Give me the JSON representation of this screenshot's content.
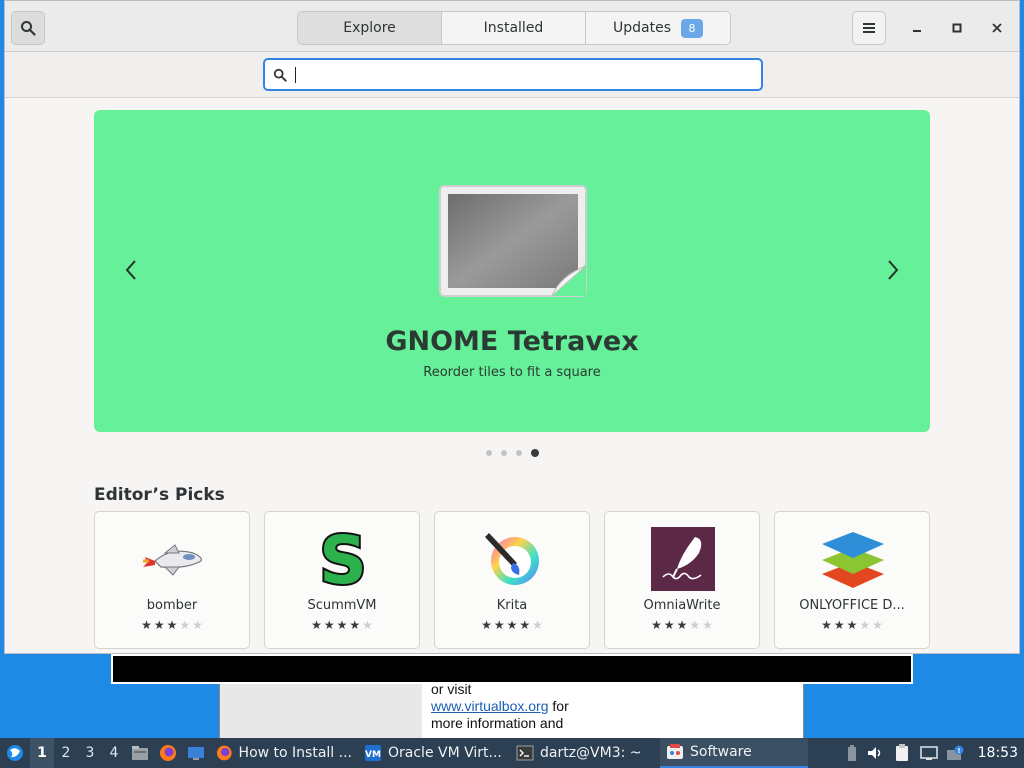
{
  "header": {
    "tabs": [
      {
        "label": "Explore",
        "active": true
      },
      {
        "label": "Installed",
        "active": false
      },
      {
        "label": "Updates",
        "active": false,
        "badge": "8"
      }
    ],
    "icons": {
      "search": "search-icon",
      "menu": "hamburger-menu-icon",
      "minimize": "minimize-icon",
      "maximize": "maximize-icon",
      "close": "close-icon"
    }
  },
  "search": {
    "placeholder": "",
    "value": ""
  },
  "banner": {
    "title": "GNOME Tetravex",
    "subtitle": "Reorder tiles to fit a square",
    "background": "#66f09a",
    "carousel_total": 4,
    "carousel_active": 4
  },
  "editors_picks": {
    "title": "Editor’s Picks",
    "apps": [
      {
        "name": "bomber",
        "rating": 3,
        "icon": "bomber-icon"
      },
      {
        "name": "ScummVM",
        "rating": 4,
        "icon": "scummvm-icon"
      },
      {
        "name": "Krita",
        "rating": 4,
        "icon": "krita-icon"
      },
      {
        "name": "OmniaWrite",
        "rating": 3,
        "icon": "omniawrite-icon"
      },
      {
        "name": "ONLYOFFICE D...",
        "rating": 3,
        "icon": "onlyoffice-icon"
      }
    ]
  },
  "background_window": {
    "line1": "or visit",
    "link": "www.virtualbox.org",
    "link_after": " for",
    "line3": "more information and"
  },
  "taskbar": {
    "workspaces": [
      "1",
      "2",
      "3",
      "4"
    ],
    "active_workspace": "1",
    "tasks": [
      {
        "label": "How to Install ...",
        "icon": "firefox-icon",
        "active": false
      },
      {
        "label": "Oracle VM Virt...",
        "icon": "virtualbox-icon",
        "active": false
      },
      {
        "label": "dartz@VM3: ~",
        "icon": "terminal-icon",
        "active": false
      },
      {
        "label": "Software",
        "icon": "software-icon",
        "active": true
      }
    ],
    "clock": "18:53"
  }
}
